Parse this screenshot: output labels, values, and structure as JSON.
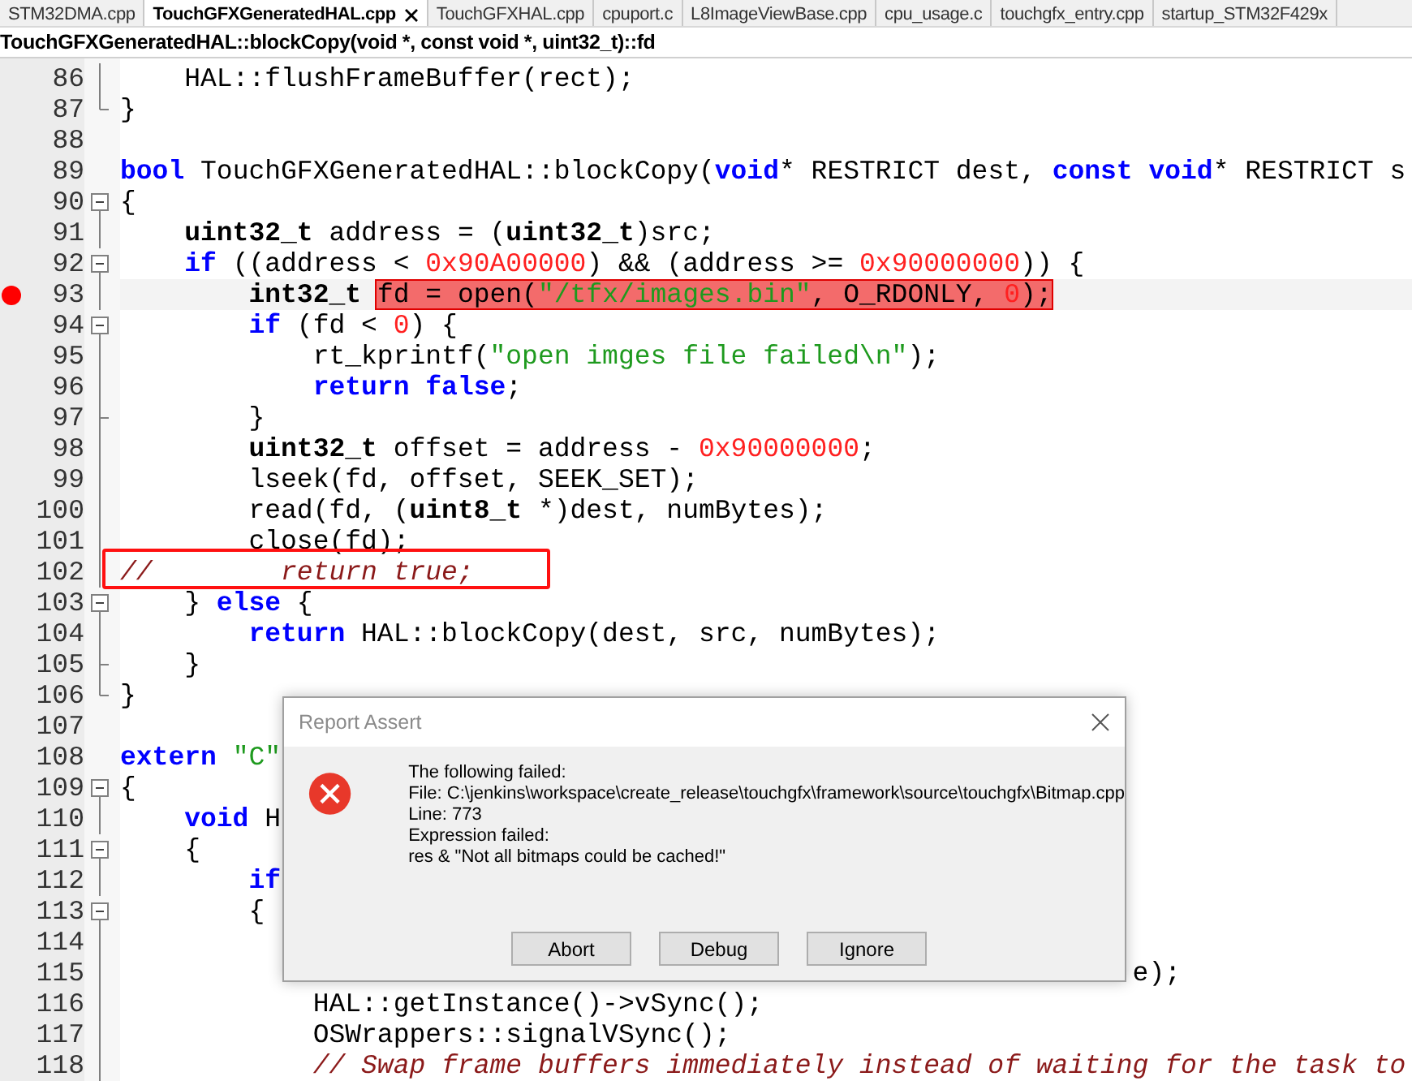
{
  "tabs": [
    {
      "label": "STM32DMA.cpp",
      "selected": false
    },
    {
      "label": "TouchGFXGeneratedHAL.cpp",
      "selected": true
    },
    {
      "label": "TouchGFXHAL.cpp",
      "selected": false
    },
    {
      "label": "cpuport.c",
      "selected": false
    },
    {
      "label": "L8ImageViewBase.cpp",
      "selected": false
    },
    {
      "label": "cpu_usage.c",
      "selected": false
    },
    {
      "label": "touchgfx_entry.cpp",
      "selected": false
    },
    {
      "label": "startup_STM32F429x",
      "selected": false
    }
  ],
  "function_bar": "TouchGFXGeneratedHAL::blockCopy(void *, const void *, uint32_t)::fd",
  "lines": [
    {
      "num": "86",
      "fold": {
        "kind": "line"
      },
      "breakpoint": false,
      "current": false,
      "annotated": false,
      "code": [
        {
          "t": "    HAL::flushFrameBuffer(rect);",
          "kind": "plain"
        }
      ]
    },
    {
      "num": "87",
      "fold": {
        "kind": "end"
      },
      "breakpoint": false,
      "current": false,
      "annotated": false,
      "code": [
        {
          "t": "}",
          "kind": "plain"
        }
      ]
    },
    {
      "num": "88",
      "breakpoint": false,
      "current": false,
      "annotated": false
    },
    {
      "num": "89",
      "breakpoint": false,
      "current": false,
      "annotated": false,
      "code": [
        {
          "t": "bool",
          "kind": "kw"
        },
        {
          "t": " TouchGFXGeneratedHAL::blockCopy(",
          "kind": "plain"
        },
        {
          "t": "void",
          "kind": "kw"
        },
        {
          "t": "* RESTRICT dest, ",
          "kind": "plain"
        },
        {
          "t": "const",
          "kind": "kw"
        },
        {
          "t": " void",
          "kind": "kw"
        },
        {
          "t": "* RESTRICT s",
          "kind": "plain"
        }
      ]
    },
    {
      "num": "90",
      "fold": {
        "kind": "start"
      },
      "breakpoint": false,
      "current": false,
      "annotated": false,
      "code": [
        {
          "t": "{",
          "kind": "plain"
        }
      ]
    },
    {
      "num": "91",
      "fold": {
        "kind": "line"
      },
      "breakpoint": false,
      "current": false,
      "annotated": false,
      "code": [
        {
          "t": "    uint32_t",
          "kind": "type"
        },
        {
          "t": " address = (",
          "kind": "plain"
        },
        {
          "t": "uint32_t",
          "kind": "type"
        },
        {
          "t": ")src;",
          "kind": "plain"
        }
      ]
    },
    {
      "num": "92",
      "fold": {
        "kind": "start"
      },
      "breakpoint": false,
      "current": false,
      "annotated": false,
      "code": [
        {
          "t": "    if",
          "kind": "kw"
        },
        {
          "t": " ((address < ",
          "kind": "plain"
        },
        {
          "t": "0x90A00000",
          "kind": "num"
        },
        {
          "t": ") && (address >= ",
          "kind": "plain"
        },
        {
          "t": "0x90000000",
          "kind": "num"
        },
        {
          "t": ")) {",
          "kind": "plain"
        }
      ]
    },
    {
      "num": "93",
      "fold": {
        "kind": "line"
      },
      "breakpoint": true,
      "current": true,
      "annotated": false,
      "code": [
        {
          "t": "        int32_t ",
          "kind": "type"
        },
        {
          "t": "fd = open(",
          "kind": "plain",
          "hl": true
        },
        {
          "t": "\"/tfx/images.bin\"",
          "kind": "str",
          "hl": true
        },
        {
          "t": ", O_RDONLY, ",
          "kind": "plain",
          "hl": true
        },
        {
          "t": "0",
          "kind": "num",
          "hl": true
        },
        {
          "t": ");",
          "kind": "plain",
          "hl": true
        }
      ]
    },
    {
      "num": "94",
      "fold": {
        "kind": "start"
      },
      "breakpoint": false,
      "current": false,
      "annotated": false,
      "code": [
        {
          "t": "        if",
          "kind": "kw"
        },
        {
          "t": " (fd < ",
          "kind": "plain"
        },
        {
          "t": "0",
          "kind": "num"
        },
        {
          "t": ") {",
          "kind": "plain"
        }
      ]
    },
    {
      "num": "95",
      "fold": {
        "kind": "line"
      },
      "breakpoint": false,
      "current": false,
      "annotated": false,
      "code": [
        {
          "t": "            rt_kprintf(",
          "kind": "plain"
        },
        {
          "t": "\"open imges file failed\\n\"",
          "kind": "str"
        },
        {
          "t": ");",
          "kind": "plain"
        }
      ]
    },
    {
      "num": "96",
      "fold": {
        "kind": "line"
      },
      "breakpoint": false,
      "current": false,
      "annotated": false,
      "code": [
        {
          "t": "            return",
          "kind": "kw"
        },
        {
          "t": " false",
          "kind": "kw"
        },
        {
          "t": ";",
          "kind": "plain"
        }
      ]
    },
    {
      "num": "97",
      "fold": {
        "kind": "mid"
      },
      "breakpoint": false,
      "current": false,
      "annotated": false,
      "code": [
        {
          "t": "        }",
          "kind": "plain"
        }
      ]
    },
    {
      "num": "98",
      "fold": {
        "kind": "line"
      },
      "breakpoint": false,
      "current": false,
      "annotated": false,
      "code": [
        {
          "t": "        uint32_t",
          "kind": "type"
        },
        {
          "t": " offset = address - ",
          "kind": "plain"
        },
        {
          "t": "0x90000000",
          "kind": "num"
        },
        {
          "t": ";",
          "kind": "plain"
        }
      ]
    },
    {
      "num": "99",
      "fold": {
        "kind": "line"
      },
      "breakpoint": false,
      "current": false,
      "annotated": false,
      "code": [
        {
          "t": "        lseek(fd, offset, SEEK_SET);",
          "kind": "plain"
        }
      ]
    },
    {
      "num": "100",
      "fold": {
        "kind": "line"
      },
      "breakpoint": false,
      "current": false,
      "annotated": false,
      "code": [
        {
          "t": "        read(fd, (",
          "kind": "plain"
        },
        {
          "t": "uint8_t",
          "kind": "type"
        },
        {
          "t": " *)dest, numBytes);",
          "kind": "plain"
        }
      ]
    },
    {
      "num": "101",
      "fold": {
        "kind": "line"
      },
      "breakpoint": false,
      "current": false,
      "annotated": false,
      "code": [
        {
          "t": "        close(fd);",
          "kind": "plain"
        }
      ]
    },
    {
      "num": "102",
      "fold": {
        "kind": "line"
      },
      "breakpoint": false,
      "current": false,
      "annotated": true,
      "code": [
        {
          "t": "//        return true;",
          "kind": "cmt"
        }
      ]
    },
    {
      "num": "103",
      "fold": {
        "kind": "start"
      },
      "breakpoint": false,
      "current": false,
      "annotated": false,
      "code": [
        {
          "t": "    } ",
          "kind": "plain"
        },
        {
          "t": "else",
          "kind": "kw"
        },
        {
          "t": " {",
          "kind": "plain"
        }
      ]
    },
    {
      "num": "104",
      "fold": {
        "kind": "line"
      },
      "breakpoint": false,
      "current": false,
      "annotated": false,
      "code": [
        {
          "t": "        return",
          "kind": "kw"
        },
        {
          "t": " HAL::blockCopy(dest, src, numBytes);",
          "kind": "plain"
        }
      ]
    },
    {
      "num": "105",
      "fold": {
        "kind": "mid"
      },
      "breakpoint": false,
      "current": false,
      "annotated": false,
      "code": [
        {
          "t": "    }",
          "kind": "plain"
        }
      ]
    },
    {
      "num": "106",
      "fold": {
        "kind": "end"
      },
      "breakpoint": false,
      "current": false,
      "annotated": false,
      "code": [
        {
          "t": "}",
          "kind": "plain"
        }
      ]
    },
    {
      "num": "107",
      "breakpoint": false,
      "current": false,
      "annotated": false
    },
    {
      "num": "108",
      "breakpoint": false,
      "current": false,
      "annotated": false,
      "code": [
        {
          "t": "extern",
          "kind": "kw"
        },
        {
          "t": " \"C\"",
          "kind": "str"
        }
      ]
    },
    {
      "num": "109",
      "fold": {
        "kind": "start"
      },
      "breakpoint": false,
      "current": false,
      "annotated": false,
      "code": [
        {
          "t": "{",
          "kind": "plain"
        }
      ]
    },
    {
      "num": "110",
      "fold": {
        "kind": "line"
      },
      "breakpoint": false,
      "current": false,
      "annotated": false,
      "code": [
        {
          "t": "    void",
          "kind": "kw"
        },
        {
          "t": " H",
          "kind": "plain"
        }
      ]
    },
    {
      "num": "111",
      "fold": {
        "kind": "start"
      },
      "breakpoint": false,
      "current": false,
      "annotated": false,
      "code": [
        {
          "t": "    {",
          "kind": "plain"
        }
      ]
    },
    {
      "num": "112",
      "fold": {
        "kind": "line"
      },
      "breakpoint": false,
      "current": false,
      "annotated": false,
      "code": [
        {
          "t": "        if",
          "kind": "kw"
        }
      ]
    },
    {
      "num": "113",
      "fold": {
        "kind": "start"
      },
      "breakpoint": false,
      "current": false,
      "annotated": false,
      "code": [
        {
          "t": "        {",
          "kind": "plain"
        }
      ]
    },
    {
      "num": "114",
      "fold": {
        "kind": "line"
      },
      "breakpoint": false,
      "current": false,
      "annotated": false
    },
    {
      "num": "115",
      "fold": {
        "kind": "line"
      },
      "breakpoint": false,
      "current": false,
      "annotated": false,
      "code": [
        {
          "t": "                                                               e);",
          "kind": "plain"
        }
      ]
    },
    {
      "num": "116",
      "fold": {
        "kind": "line"
      },
      "breakpoint": false,
      "current": false,
      "annotated": false,
      "code": [
        {
          "t": "            HAL::getInstance()->vSync();",
          "kind": "plain"
        }
      ]
    },
    {
      "num": "117",
      "fold": {
        "kind": "line"
      },
      "breakpoint": false,
      "current": false,
      "annotated": false,
      "code": [
        {
          "t": "            OSWrappers::signalVSync();",
          "kind": "plain"
        }
      ]
    },
    {
      "num": "118",
      "fold": {
        "kind": "line"
      },
      "breakpoint": false,
      "current": false,
      "annotated": false,
      "code": [
        {
          "t": "            // Swap frame buffers immediately instead of waiting for the task to",
          "kind": "cmt"
        }
      ]
    }
  ],
  "dialog": {
    "title": "Report Assert",
    "message": [
      "The following failed:",
      "File: C:\\jenkins\\workspace\\create_release\\touchgfx\\framework\\source\\touchgfx\\Bitmap.cpp",
      "Line: 773",
      "Expression failed:",
      "res & \"Not all bitmaps could be cached!\""
    ],
    "buttons": [
      "Abort",
      "Debug",
      "Ignore"
    ]
  }
}
